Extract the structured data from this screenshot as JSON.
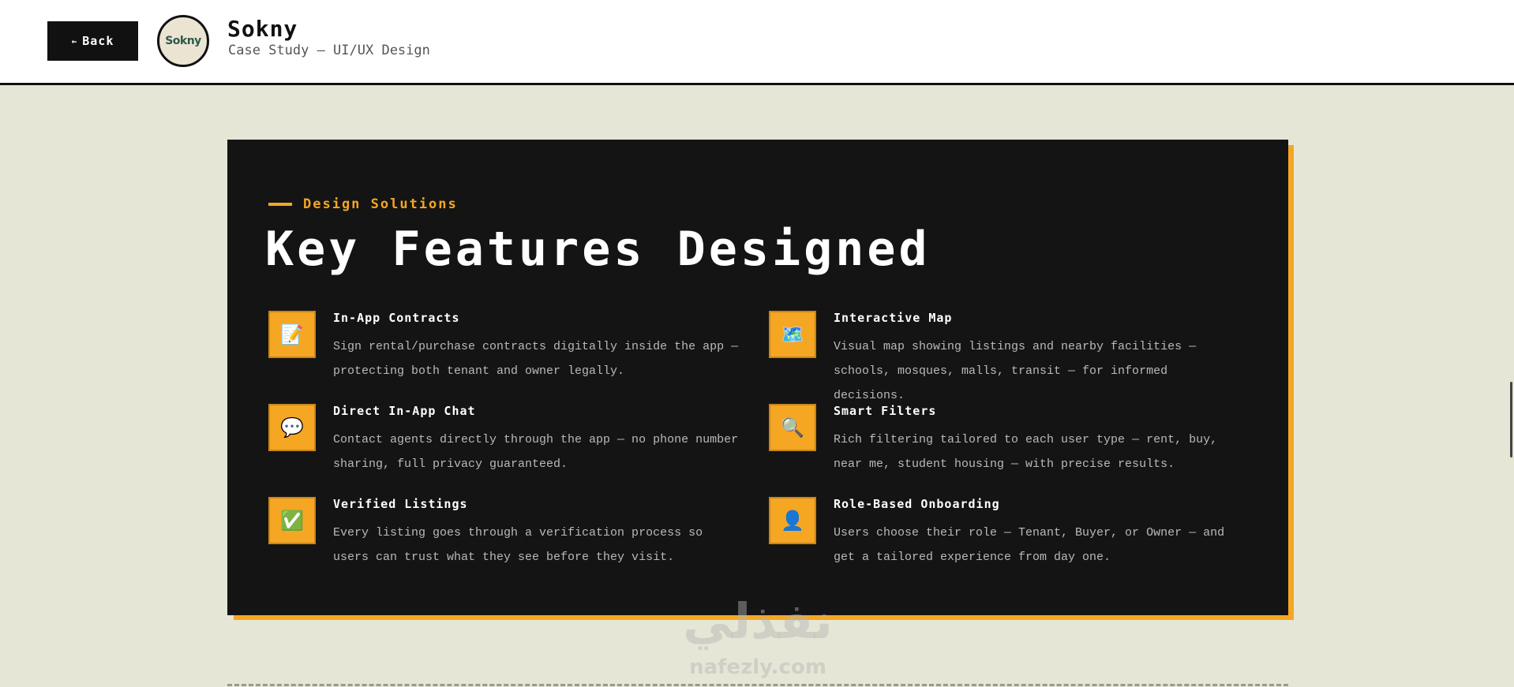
{
  "header": {
    "back_label": "Back",
    "back_arrow": "←",
    "logo_text": "Sokny",
    "brand_name": "Sokny",
    "brand_subtitle": "Case Study — UI/UX Design"
  },
  "section": {
    "eyebrow": "Design Solutions",
    "title": "Key Features Designed"
  },
  "features": [
    {
      "icon": "contract-icon",
      "emoji": "📝",
      "title": "In-App Contracts",
      "description": "Sign rental/purchase contracts digitally inside the app — protecting both tenant and owner legally."
    },
    {
      "icon": "map-icon",
      "emoji": "🗺️",
      "title": "Interactive Map",
      "description": "Visual map showing listings and nearby facilities — schools, mosques, malls, transit — for informed decisions."
    },
    {
      "icon": "chat-icon",
      "emoji": "💬",
      "title": "Direct In-App Chat",
      "description": "Contact agents directly through the app — no phone number sharing, full privacy guaranteed."
    },
    {
      "icon": "search-icon",
      "emoji": "🔍",
      "title": "Smart Filters",
      "description": "Rich filtering tailored to each user type — rent, buy, near me, student housing — with precise results."
    },
    {
      "icon": "checkmark-icon",
      "emoji": "✅",
      "title": "Verified Listings",
      "description": "Every listing goes through a verification process so users can trust what they see before they visit."
    },
    {
      "icon": "user-icon",
      "emoji": "👤",
      "title": "Role-Based Onboarding",
      "description": "Users choose their role — Tenant, Buyer, or Owner — and get a tailored experience from day one."
    }
  ],
  "watermark": {
    "main": "نفذلي",
    "url": "nafezly.com"
  },
  "colors": {
    "accent": "#f5a623",
    "card_bg": "#141414",
    "page_bg": "#e6e6d6"
  }
}
